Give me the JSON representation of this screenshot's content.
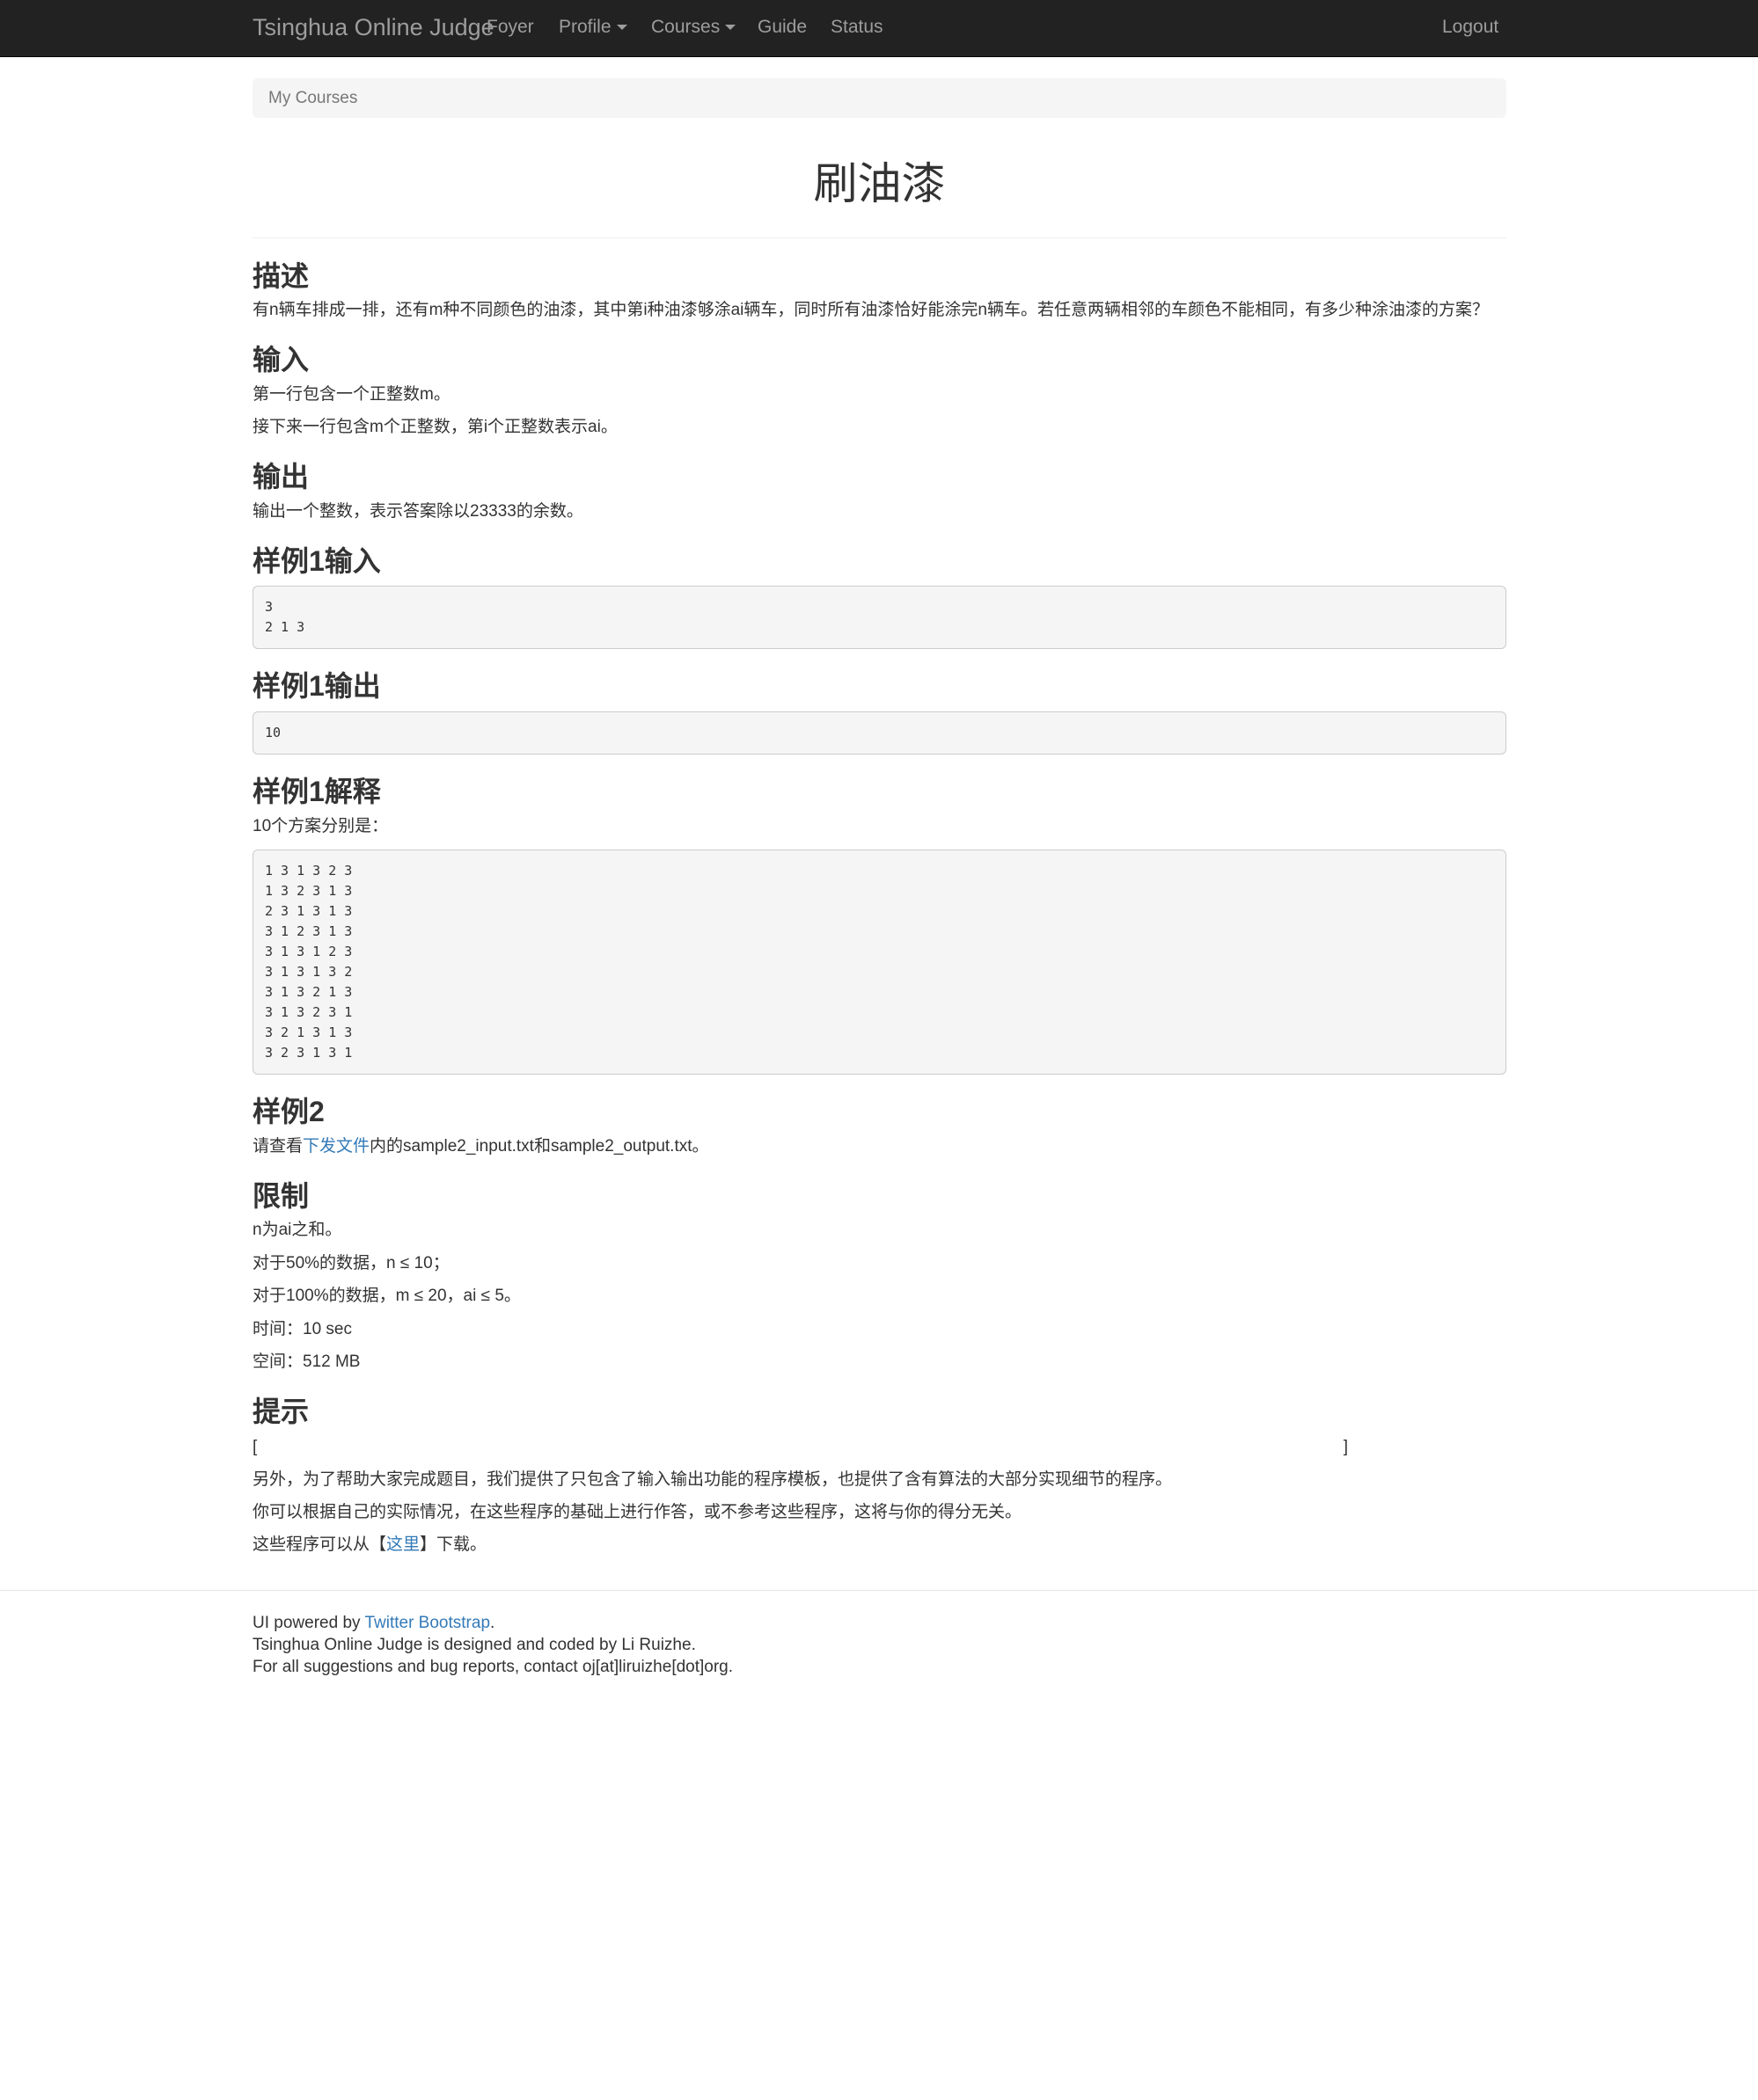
{
  "navbar": {
    "brand": "Tsinghua Online Judge",
    "items": [
      {
        "label": "Foyer"
      },
      {
        "label": "Profile"
      },
      {
        "label": "Courses"
      },
      {
        "label": "Guide"
      },
      {
        "label": "Status"
      }
    ],
    "logout": "Logout"
  },
  "breadcrumb": {
    "label": "My Courses"
  },
  "problem": {
    "title": "刷油漆",
    "description": {
      "heading": "描述",
      "text": "有n辆车排成一排，还有m种不同颜色的油漆，其中第i种油漆够涂ai辆车，同时所有油漆恰好能涂完n辆车。若任意两辆相邻的车颜色不能相同，有多少种涂油漆的方案？"
    },
    "input": {
      "heading": "输入",
      "lines": [
        "第一行包含一个正整数m。",
        "接下来一行包含m个正整数，第i个正整数表示ai。"
      ]
    },
    "output": {
      "heading": "输出",
      "text": "输出一个整数，表示答案除以23333的余数。"
    },
    "sample1_input": {
      "heading": "样例1输入",
      "code": "3\n2 1 3"
    },
    "sample1_output": {
      "heading": "样例1输出",
      "code": "10"
    },
    "sample1_explain": {
      "heading": "样例1解释",
      "text": "10个方案分别是：",
      "code": "1 3 1 3 2 3\n1 3 2 3 1 3\n2 3 1 3 1 3\n3 1 2 3 1 3\n3 1 3 1 2 3\n3 1 3 1 3 2\n3 1 3 2 1 3\n3 1 3 2 3 1\n3 2 1 3 1 3\n3 2 3 1 3 1"
    },
    "sample2": {
      "heading": "样例2",
      "prefix": "请查看",
      "link": "下发文件",
      "suffix": "内的sample2_input.txt和sample2_output.txt。"
    },
    "limits": {
      "heading": "限制",
      "lines": [
        "n为ai之和。",
        "对于50%的数据，n ≤ 10；",
        "对于100%的数据，m ≤ 20，ai ≤ 5。",
        "时间：10 sec",
        "空间：512 MB"
      ]
    },
    "hint": {
      "heading": "提示",
      "bracket_open": "[",
      "bracket_close": "]",
      "lines": [
        "另外，为了帮助大家完成题目，我们提供了只包含了输入输出功能的程序模板，也提供了含有算法的大部分实现细节的程序。",
        "你可以根据自己的实际情况，在这些程序的基础上进行作答，或不参考这些程序，这将与你的得分无关。"
      ],
      "download_prefix": "这些程序可以从【",
      "download_link": "这里",
      "download_suffix": "】下载。"
    }
  },
  "footer": {
    "line1_prefix": "UI powered by ",
    "line1_link": "Twitter Bootstrap",
    "line1_suffix": ".",
    "line2": "Tsinghua Online Judge is designed and coded by Li Ruizhe.",
    "line3": "For all suggestions and bug reports, contact oj[at]liruizhe[dot]org."
  }
}
